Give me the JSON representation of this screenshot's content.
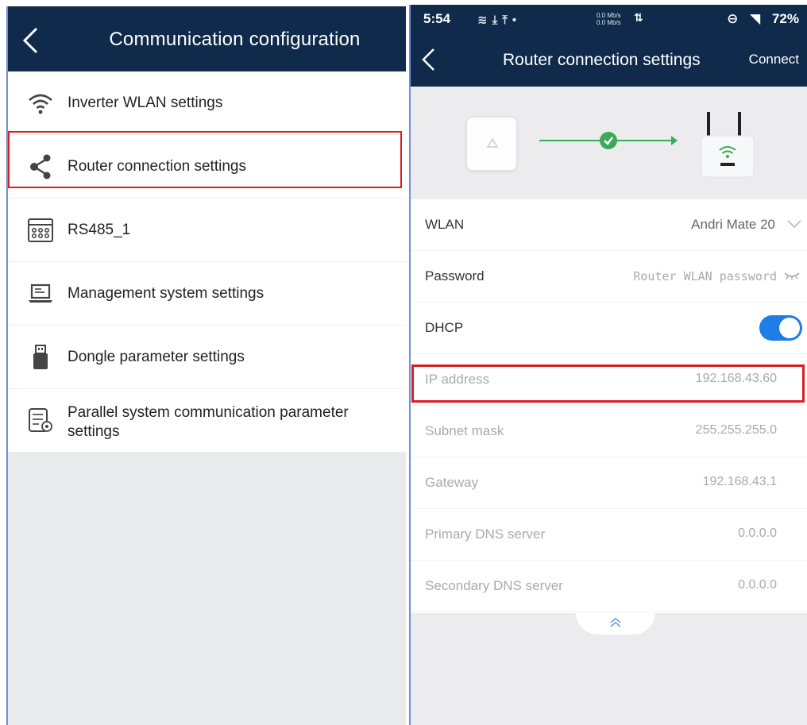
{
  "left_panel": {
    "title": "Communication configuration",
    "items": [
      {
        "label": "Inverter WLAN settings",
        "icon": "wifi-icon"
      },
      {
        "label": "Router connection settings",
        "icon": "share-icon"
      },
      {
        "label": "RS485_1",
        "icon": "rs485-port-icon"
      },
      {
        "label": "Management system settings",
        "icon": "laptop-icon"
      },
      {
        "label": "Dongle parameter settings",
        "icon": "usb-dongle-icon"
      },
      {
        "label": "Parallel system communication parameter settings",
        "icon": "parallel-settings-icon"
      }
    ],
    "highlighted_item": "Router connection settings"
  },
  "right_panel": {
    "status_bar": {
      "time": "5:54",
      "speed_up": "0.0 Mb/s",
      "speed_down": "0.0 Mb/s",
      "battery": "72%"
    },
    "title": "Router connection settings",
    "connect_label": "Connect",
    "fields": {
      "wlan": {
        "label": "WLAN",
        "value": "Andri Mate 20"
      },
      "password": {
        "label": "Password",
        "placeholder": "Router WLAN password"
      },
      "dhcp": {
        "label": "DHCP",
        "enabled": true
      },
      "ip_address": {
        "label": "IP address",
        "value": "192.168.43.60"
      },
      "subnet_mask": {
        "label": "Subnet mask",
        "value": "255.255.255.0"
      },
      "gateway": {
        "label": "Gateway",
        "value": "192.168.43.1"
      },
      "primary_dns": {
        "label": "Primary DNS server",
        "value": "0.0.0.0"
      },
      "secondary_dns": {
        "label": "Secondary DNS server",
        "value": "0.0.0.0"
      }
    },
    "colors": {
      "header_bg": "#0f2a4a",
      "toggle_on": "#1e7de6",
      "connection_line": "#3aa95a",
      "highlight_border": "#d81f26"
    }
  }
}
